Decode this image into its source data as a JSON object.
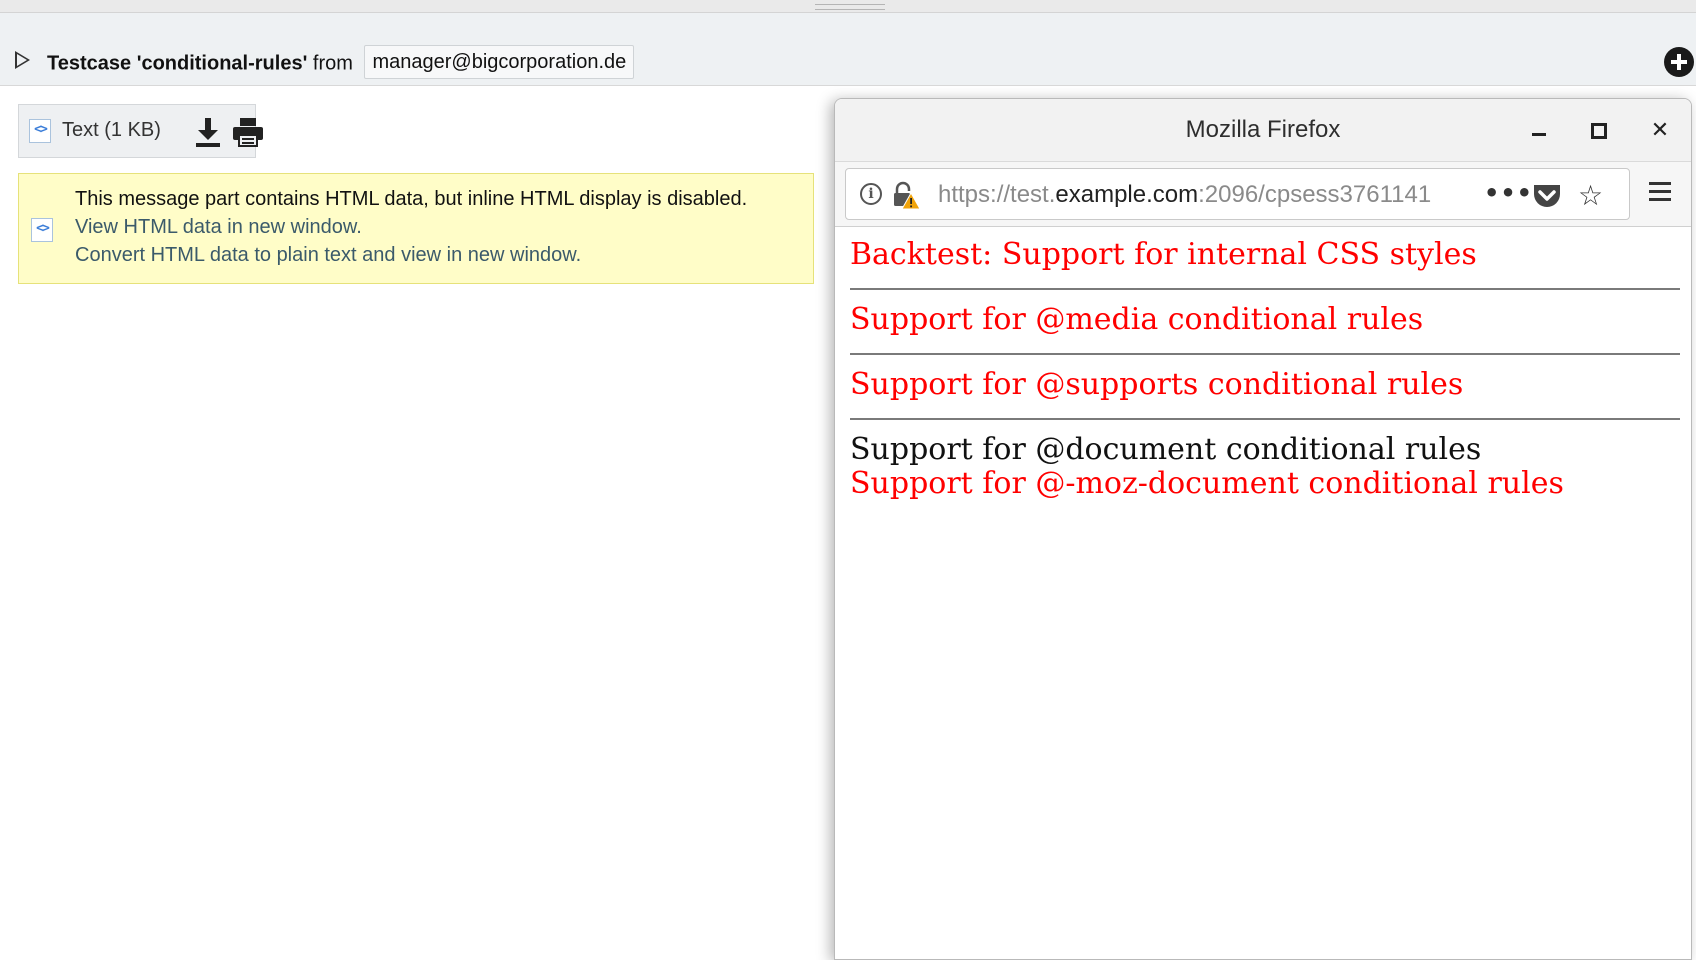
{
  "header": {
    "subject": "Testcase 'conditional-rules'",
    "from_word": "from",
    "sender": "manager@bigcorporation.de"
  },
  "attachment": {
    "label": "Text (1 KB)"
  },
  "notice": {
    "message": "This message part contains HTML data, but inline HTML display is disabled.",
    "view_link": "View HTML data in new window.",
    "convert_link": "Convert HTML data to plain text and view in new window."
  },
  "firefox": {
    "title": "Mozilla Firefox",
    "url_prefix": "https://test.",
    "url_host": "example.com",
    "url_suffix": ":2096/cpsess3761141",
    "more": "•••",
    "star": "☆",
    "close": "✕"
  },
  "content": {
    "lines": [
      {
        "text": "Backtest: Support for internal CSS styles",
        "color": "#ff0000"
      },
      {
        "text": "Support for @media conditional rules",
        "color": "#ff0000"
      },
      {
        "text": "Support for @supports conditional rules",
        "color": "#ff0000"
      },
      {
        "text": "Support for @document conditional rules",
        "color": "#111111"
      },
      {
        "text": "Support for @-moz-document conditional rules",
        "color": "#ff0000"
      }
    ]
  },
  "icons": {
    "expander": "triangle-right-icon",
    "add": "plus-circle-icon",
    "attachment": "html-code-icon",
    "download": "download-icon",
    "print": "printer-icon",
    "info": "info-icon",
    "lock": "insecure-lock-icon",
    "pocket": "pocket-icon",
    "bookmark": "star-icon",
    "menu": "hamburger-menu-icon"
  }
}
